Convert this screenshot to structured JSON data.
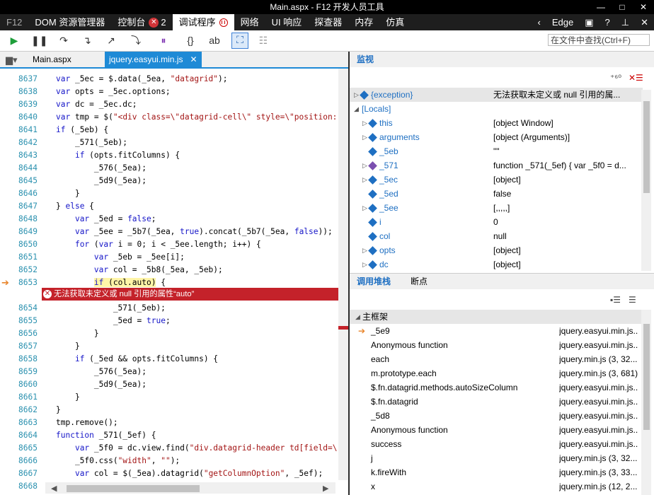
{
  "window": {
    "title": "Main.aspx - F12 开发人员工具",
    "controls": [
      "—",
      "□",
      "✕"
    ]
  },
  "tabs": {
    "f12": "F12",
    "items": [
      {
        "label": "DOM 资源管理器"
      },
      {
        "label": "控制台",
        "badge": "2"
      },
      {
        "label": "调试程序"
      },
      {
        "label": "网络"
      },
      {
        "label": "UI 响应"
      },
      {
        "label": "探查器"
      },
      {
        "label": "内存"
      },
      {
        "label": "仿真"
      }
    ],
    "right_label": "Edge",
    "help": "?"
  },
  "toolbar": {
    "find_placeholder": "在文件中查找(Ctrl+F)",
    "icons": [
      "play-icon",
      "pause-icon",
      "step-over-icon",
      "step-into-icon",
      "step-out-icon",
      "break-new-worker-icon",
      "exceptions-icon",
      "pretty-print-icon",
      "word-wrap-icon",
      "just-my-code-icon",
      "source-map-icon"
    ]
  },
  "files": {
    "tabs": [
      {
        "label": "Main.aspx"
      },
      {
        "label": "jquery.easyui.min.js",
        "active": true
      }
    ]
  },
  "code": {
    "lines": [
      {
        "n": "8637",
        "t": "var _5ec = $.data(_5ea, \"datagrid\");"
      },
      {
        "n": "8638",
        "t": "var opts = _5ec.options;"
      },
      {
        "n": "8639",
        "t": "var dc = _5ec.dc;"
      },
      {
        "n": "8640",
        "t": "var tmp = $(\"<div class=\\\"datagrid-cell\\\" style=\\\"position:"
      },
      {
        "n": "8641",
        "t": "if (_5eb) {"
      },
      {
        "n": "8642",
        "t": "    _571(_5eb);"
      },
      {
        "n": "8643",
        "t": "    if (opts.fitColumns) {"
      },
      {
        "n": "8644",
        "t": "        _576(_5ea);"
      },
      {
        "n": "8645",
        "t": "        _5d9(_5ea);"
      },
      {
        "n": "8646",
        "t": "    }"
      },
      {
        "n": "8647",
        "t": "} else {"
      },
      {
        "n": "8648",
        "t": "    var _5ed = false;"
      },
      {
        "n": "8649",
        "t": "    var _5ee = _5b7(_5ea, true).concat(_5b7(_5ea, false));"
      },
      {
        "n": "8650",
        "t": "    for (var i = 0; i < _5ee.length; i++) {"
      },
      {
        "n": "8651",
        "t": "        var _5eb = _5ee[i];"
      },
      {
        "n": "8652",
        "t": "        var col = _5b8(_5ea, _5eb);"
      },
      {
        "n": "8653",
        "t": "        if (col.auto) {"
      },
      {
        "n": "8654",
        "t": "            _571(_5eb);"
      },
      {
        "n": "8655",
        "t": "            _5ed = true;"
      },
      {
        "n": "8656",
        "t": "        }"
      },
      {
        "n": "8657",
        "t": "    }"
      },
      {
        "n": "8658",
        "t": "    if (_5ed && opts.fitColumns) {"
      },
      {
        "n": "8659",
        "t": "        _576(_5ea);"
      },
      {
        "n": "8660",
        "t": "        _5d9(_5ea);"
      },
      {
        "n": "8661",
        "t": "    }"
      },
      {
        "n": "8662",
        "t": "}"
      },
      {
        "n": "8663",
        "t": "tmp.remove();"
      },
      {
        "n": "8664",
        "t": "function _571(_5ef) {"
      },
      {
        "n": "8665",
        "t": "    var _5f0 = dc.view.find(\"div.datagrid-header td[field=\\"
      },
      {
        "n": "8666",
        "t": "    _5f0.css(\"width\", \"\");"
      },
      {
        "n": "8667",
        "t": "    var col = $(_5ea).datagrid(\"getColumnOption\", _5ef);"
      },
      {
        "n": "8668",
        "t": "    col.width = undefined;"
      }
    ],
    "exception_text": "无法获取未定义或 null 引用的属性“auto”"
  },
  "watch": {
    "title": "监视",
    "rows": [
      {
        "name": "{exception}",
        "value": "无法获取未定义或 null 引用的属...",
        "level": 0,
        "expand": true,
        "exc": true
      },
      {
        "name": "[Locals]",
        "value": "",
        "level": 0,
        "expand": "open"
      },
      {
        "name": "this",
        "value": "[object Window]",
        "level": 1,
        "expand": true
      },
      {
        "name": "arguments",
        "value": "[object (Arguments)]",
        "level": 1,
        "expand": true
      },
      {
        "name": "_5eb",
        "value": "\"\"",
        "level": 1,
        "expand": false
      },
      {
        "name": "_571",
        "value": "function _571(_5ef) { var _5f0 = d...",
        "level": 1,
        "expand": true,
        "fn": true
      },
      {
        "name": "_5ec",
        "value": "[object]",
        "level": 1,
        "expand": true
      },
      {
        "name": "_5ed",
        "value": "false",
        "level": 1,
        "expand": false
      },
      {
        "name": "_5ee",
        "value": "[,,,,,]",
        "level": 1,
        "expand": true
      },
      {
        "name": "i",
        "value": "0",
        "level": 1,
        "expand": false
      },
      {
        "name": "col",
        "value": "null",
        "level": 1,
        "expand": false
      },
      {
        "name": "opts",
        "value": "[object]",
        "level": 1,
        "expand": true
      },
      {
        "name": "dc",
        "value": "[object]",
        "level": 1,
        "expand": true
      }
    ]
  },
  "callstack": {
    "tabs": [
      "调用堆栈",
      "断点"
    ],
    "group": "主框架",
    "frames": [
      {
        "fn": "_5e9",
        "loc": "jquery.easyui.min.js...",
        "current": true
      },
      {
        "fn": "Anonymous function",
        "loc": "jquery.easyui.min.js..."
      },
      {
        "fn": "each",
        "loc": "jquery.min.js (3, 32..."
      },
      {
        "fn": "m.prototype.each",
        "loc": "jquery.min.js (3, 681)"
      },
      {
        "fn": "$.fn.datagrid.methods.autoSizeColumn",
        "loc": "jquery.easyui.min.js..."
      },
      {
        "fn": "$.fn.datagrid",
        "loc": "jquery.easyui.min.js..."
      },
      {
        "fn": "_5d8",
        "loc": "jquery.easyui.min.js..."
      },
      {
        "fn": "Anonymous function",
        "loc": "jquery.easyui.min.js..."
      },
      {
        "fn": "success",
        "loc": "jquery.easyui.min.js..."
      },
      {
        "fn": "j",
        "loc": "jquery.min.js (3, 32..."
      },
      {
        "fn": "k.fireWith",
        "loc": "jquery.min.js (3, 33..."
      },
      {
        "fn": "x",
        "loc": "jquery.min.js (12, 2..."
      }
    ]
  }
}
